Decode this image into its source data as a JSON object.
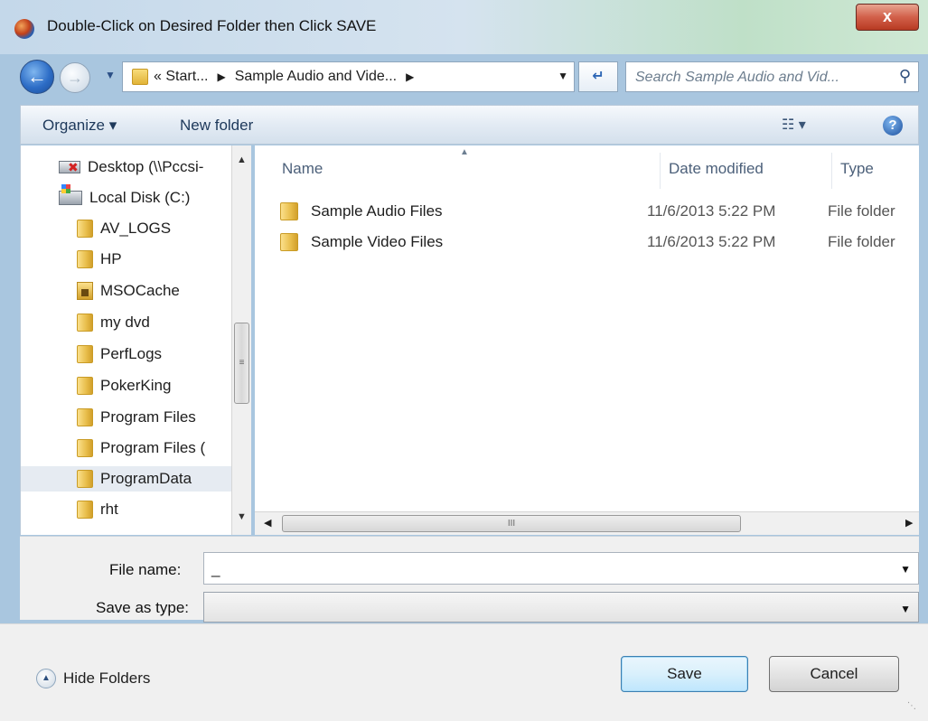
{
  "window": {
    "title": "Double-Click on Desired Folder then Click SAVE",
    "close_label": "x"
  },
  "nav": {
    "back_icon": "back-arrow-icon",
    "forward_icon": "forward-arrow-icon",
    "address_crumbs": [
      "« Start...",
      "Sample Audio and Vide..."
    ],
    "search_placeholder": "Search Sample Audio and Vid..."
  },
  "toolbar": {
    "organize_label": "Organize ▾",
    "new_folder_label": "New folder",
    "views_label": "☷ ▾",
    "help_label": "?"
  },
  "tree": {
    "items": [
      {
        "label": "Desktop (\\\\Pccsi-",
        "icon": "network-drive-icon"
      },
      {
        "label": "Local Disk (C:)",
        "icon": "local-disk-icon"
      },
      {
        "label": "AV_LOGS",
        "icon": "folder-icon"
      },
      {
        "label": "HP",
        "icon": "folder-icon"
      },
      {
        "label": "MSOCache",
        "icon": "locked-folder-icon"
      },
      {
        "label": "my dvd",
        "icon": "folder-icon"
      },
      {
        "label": "PerfLogs",
        "icon": "folder-icon"
      },
      {
        "label": "PokerKing",
        "icon": "folder-icon"
      },
      {
        "label": "Program Files",
        "icon": "folder-icon"
      },
      {
        "label": "Program Files (",
        "icon": "folder-icon"
      },
      {
        "label": "ProgramData",
        "icon": "folder-icon",
        "selected": true
      },
      {
        "label": "rht",
        "icon": "folder-icon"
      }
    ]
  },
  "files": {
    "columns": [
      "Name",
      "Date modified",
      "Type"
    ],
    "rows": [
      {
        "name": "Sample Audio Files",
        "date": "11/6/2013 5:22 PM",
        "type": "File folder"
      },
      {
        "name": "Sample Video Files",
        "date": "11/6/2013 5:22 PM",
        "type": "File folder"
      }
    ]
  },
  "form": {
    "file_name_label": "File name:",
    "file_name_value": "_",
    "save_as_type_label": "Save as type:",
    "save_as_type_value": ""
  },
  "footer": {
    "hide_folders_label": "Hide Folders",
    "save_label": "Save",
    "cancel_label": "Cancel"
  },
  "colors": {
    "accent": "#2d6dc6",
    "selected_row": "#e6ebf2",
    "close_button": "#c7432a"
  }
}
